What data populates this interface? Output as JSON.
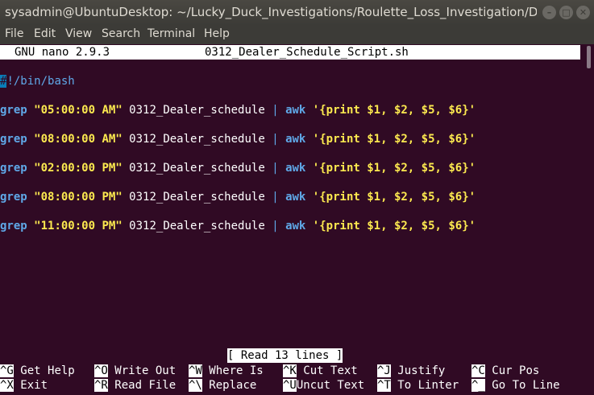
{
  "window": {
    "title": "sysadmin@UbuntuDesktop: ~/Lucky_Duck_Investigations/Roulette_Loss_Investigation/De...",
    "min_glyph": "–",
    "max_glyph": "□",
    "close_glyph": "✕"
  },
  "menu": [
    "File",
    "Edit",
    "View",
    "Search",
    "Terminal",
    "Help"
  ],
  "nano": {
    "version": "GNU nano 2.9.3",
    "filename": "0312_Dealer_Schedule_Script.sh",
    "status": "[ Read 13 lines ]"
  },
  "editor": {
    "shebang_hash": "#",
    "shebang_rest": "!/bin/bash",
    "command_lines": [
      {
        "cmd": "grep",
        "pattern": "\"05:00:00 AM\"",
        "file": "0312_Dealer_schedule",
        "pipe": "|",
        "awk": "awk",
        "awk_program": "'{print $1, $2, $5, $6}'"
      },
      {
        "cmd": "grep",
        "pattern": "\"08:00:00 AM\"",
        "file": "0312_Dealer_schedule",
        "pipe": "|",
        "awk": "awk",
        "awk_program": "'{print $1, $2, $5, $6}'"
      },
      {
        "cmd": "grep",
        "pattern": "\"02:00:00 PM\"",
        "file": "0312_Dealer_schedule",
        "pipe": "|",
        "awk": "awk",
        "awk_program": "'{print $1, $2, $5, $6}'"
      },
      {
        "cmd": "grep",
        "pattern": "\"08:00:00 PM\"",
        "file": "0312_Dealer_schedule",
        "pipe": "|",
        "awk": "awk",
        "awk_program": "'{print $1, $2, $5, $6}'"
      },
      {
        "cmd": "grep",
        "pattern": "\"11:00:00 PM\"",
        "file": "0312_Dealer_schedule",
        "pipe": "|",
        "awk": "awk",
        "awk_program": "'{print $1, $2, $5, $6}'"
      }
    ]
  },
  "shortcuts": {
    "row1": [
      {
        "key": "^G",
        "label": "Get Help"
      },
      {
        "key": "^O",
        "label": "Write Out"
      },
      {
        "key": "^W",
        "label": "Where Is"
      },
      {
        "key": "^K",
        "label": "Cut Text"
      },
      {
        "key": "^J",
        "label": "Justify"
      },
      {
        "key": "^C",
        "label": "Cur Pos"
      }
    ],
    "row2": [
      {
        "key": "^X",
        "label": "Exit"
      },
      {
        "key": "^R",
        "label": "Read File"
      },
      {
        "key": "^\\",
        "label": "Replace"
      },
      {
        "key": "^U",
        "label": "Uncut Text"
      },
      {
        "key": "^T",
        "label": "To Linter"
      },
      {
        "key": "^_",
        "label": "Go To Line"
      }
    ]
  }
}
